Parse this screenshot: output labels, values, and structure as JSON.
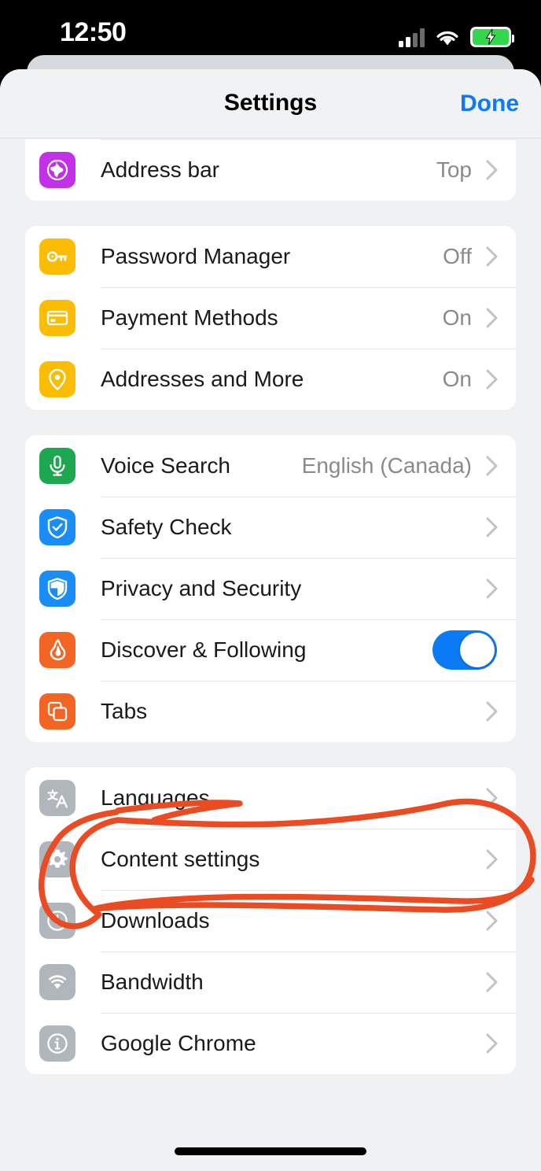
{
  "status_bar": {
    "time": "12:50",
    "cellular_icon": "cellular-bars-icon",
    "cellular_bars_filled": 2,
    "cellular_bars_total": 4,
    "wifi_icon": "wifi-icon",
    "battery_icon": "battery-charging-icon",
    "battery_charging": true,
    "battery_color": "#32D74B"
  },
  "navbar": {
    "title": "Settings",
    "done_label": "Done",
    "done_color": "#0A7AFF"
  },
  "colors": {
    "page_background": "#EFF1F3",
    "card_background": "#FFFFFF",
    "separator": "#E4E6E8",
    "primary_text": "#1A1A1A",
    "secondary_text": "#8A8A8E",
    "chevron": "#C2C2C6",
    "accent_blue": "#0B7BF5",
    "icon_purple": "#C231E8",
    "icon_yellow": "#FBBC04",
    "icon_green": "#1DA750",
    "icon_blue": "#1A8CF5",
    "icon_orange": "#F26522",
    "icon_gray": "#B0B6BC",
    "annotation_red": "#EB4B23"
  },
  "groups": [
    {
      "partial": true,
      "rows": [
        {
          "label": "Address bar",
          "value": "Top",
          "icon": "globe-icon",
          "icon_color": "#C231E8",
          "accessory": "chevron"
        }
      ]
    },
    {
      "partial": false,
      "rows": [
        {
          "label": "Password Manager",
          "value": "Off",
          "icon": "key-icon",
          "icon_color": "#FBBC04",
          "accessory": "chevron"
        },
        {
          "label": "Payment Methods",
          "value": "On",
          "icon": "credit-card-icon",
          "icon_color": "#FBBC04",
          "accessory": "chevron"
        },
        {
          "label": "Addresses and More",
          "value": "On",
          "icon": "location-pin-icon",
          "icon_color": "#FBBC04",
          "accessory": "chevron"
        }
      ]
    },
    {
      "partial": false,
      "rows": [
        {
          "label": "Voice Search",
          "value": "English (Canada)",
          "icon": "microphone-icon",
          "icon_color": "#1DA750",
          "accessory": "chevron"
        },
        {
          "label": "Safety Check",
          "value": "",
          "icon": "shield-check-icon",
          "icon_color": "#1A8CF5",
          "accessory": "chevron"
        },
        {
          "label": "Privacy and Security",
          "value": "",
          "icon": "shield-icon",
          "icon_color": "#1A8CF5",
          "accessory": "chevron"
        },
        {
          "label": "Discover & Following",
          "value": "",
          "icon": "flame-icon",
          "icon_color": "#F26522",
          "accessory": "switch",
          "switch_on": true
        },
        {
          "label": "Tabs",
          "value": "",
          "icon": "tabs-icon",
          "icon_color": "#F26522",
          "accessory": "chevron"
        }
      ]
    },
    {
      "partial": false,
      "rows": [
        {
          "label": "Languages",
          "value": "",
          "icon": "translate-icon",
          "icon_color": "#B0B6BC",
          "accessory": "chevron"
        },
        {
          "label": "Content settings",
          "value": "",
          "icon": "gear-icon",
          "icon_color": "#B0B6BC",
          "accessory": "chevron"
        },
        {
          "label": "Downloads",
          "value": "",
          "icon": "download-circle-icon",
          "icon_color": "#B0B6BC",
          "accessory": "chevron"
        },
        {
          "label": "Bandwidth",
          "value": "",
          "icon": "wifi-icon",
          "icon_color": "#B0B6BC",
          "accessory": "chevron"
        },
        {
          "label": "Google Chrome",
          "value": "",
          "icon": "info-circle-icon",
          "icon_color": "#B0B6BC",
          "accessory": "chevron"
        }
      ]
    }
  ],
  "annotation": {
    "type": "hand-drawn-lasso",
    "color": "#EB4B23",
    "stroke_width": 7,
    "encircles": [
      "Languages",
      "Content settings"
    ]
  },
  "home_indicator": "home-indicator"
}
